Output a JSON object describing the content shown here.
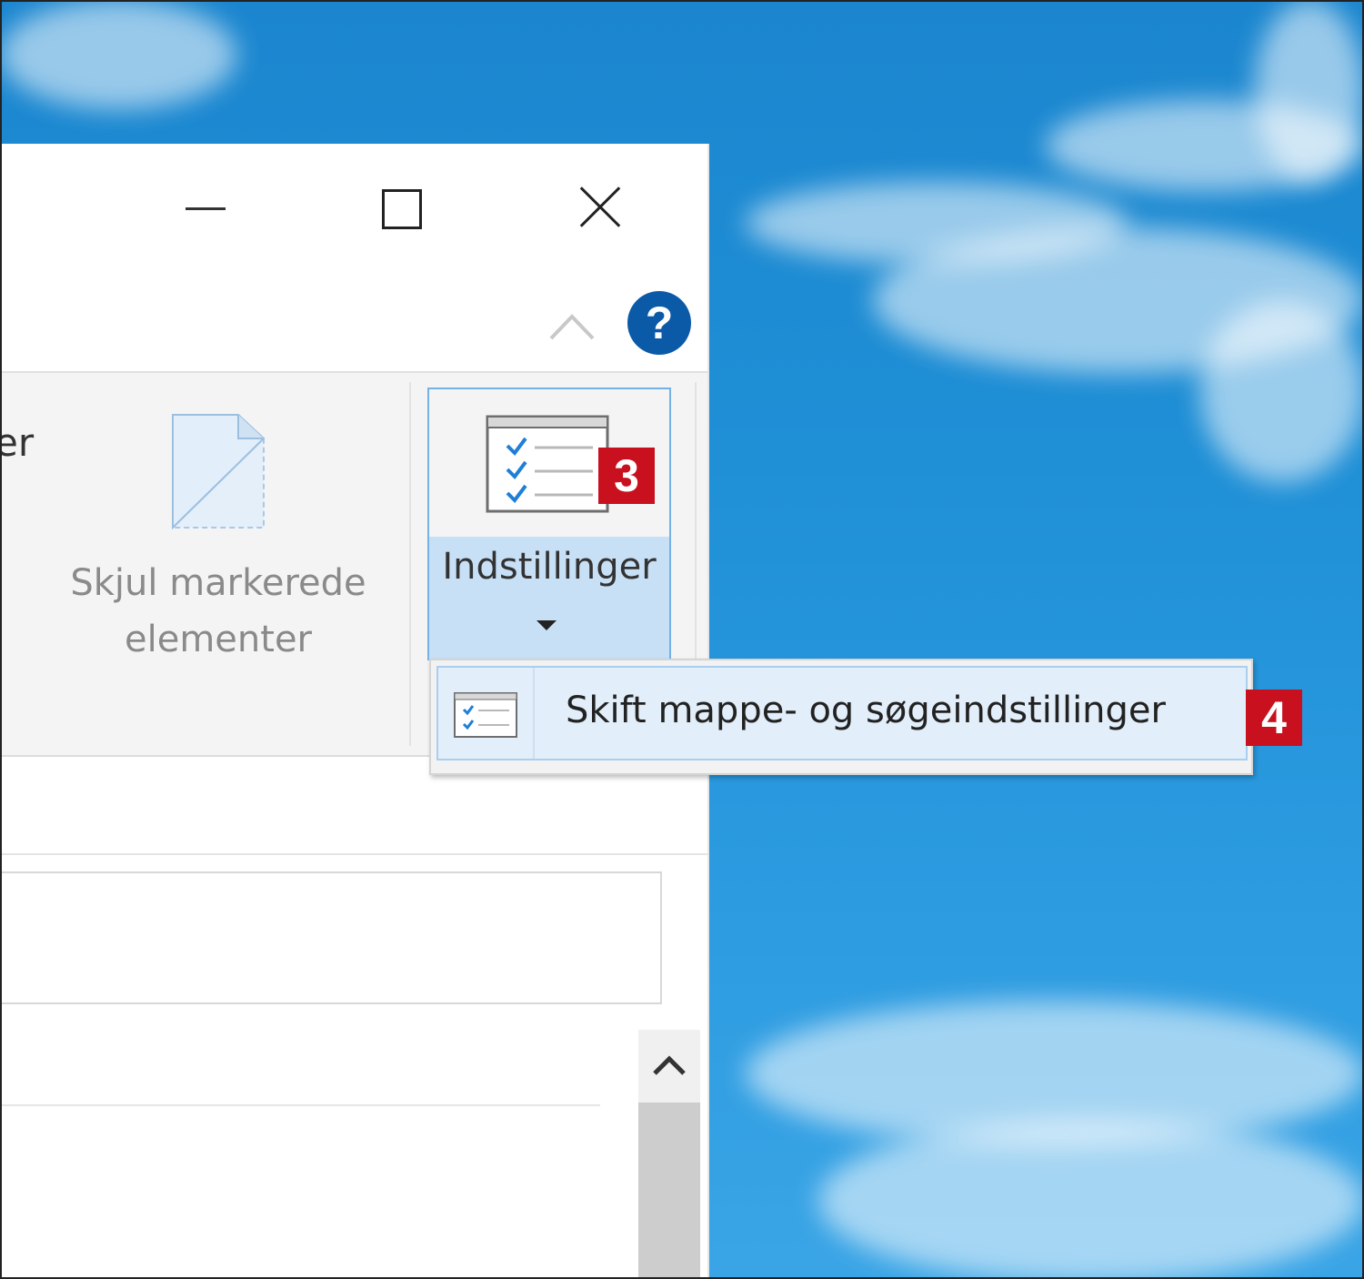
{
  "window": {
    "controls": {
      "minimize": "minimize-icon",
      "maximize": "maximize-icon",
      "close": "close-icon"
    },
    "help_label": "?"
  },
  "ribbon": {
    "partial_label": "er",
    "hide_selected_label": "Skjul markerede elementer",
    "options_label": "Indstillinger"
  },
  "dropdown": {
    "items": [
      {
        "label": "Skift mappe- og søgeindstillinger"
      }
    ]
  },
  "badges": {
    "step3": "3",
    "step4": "4"
  },
  "colors": {
    "accent": "#74b2e6",
    "badge": "#c8101e",
    "help": "#0b5aa8",
    "desktop": "#1f8fd6"
  }
}
